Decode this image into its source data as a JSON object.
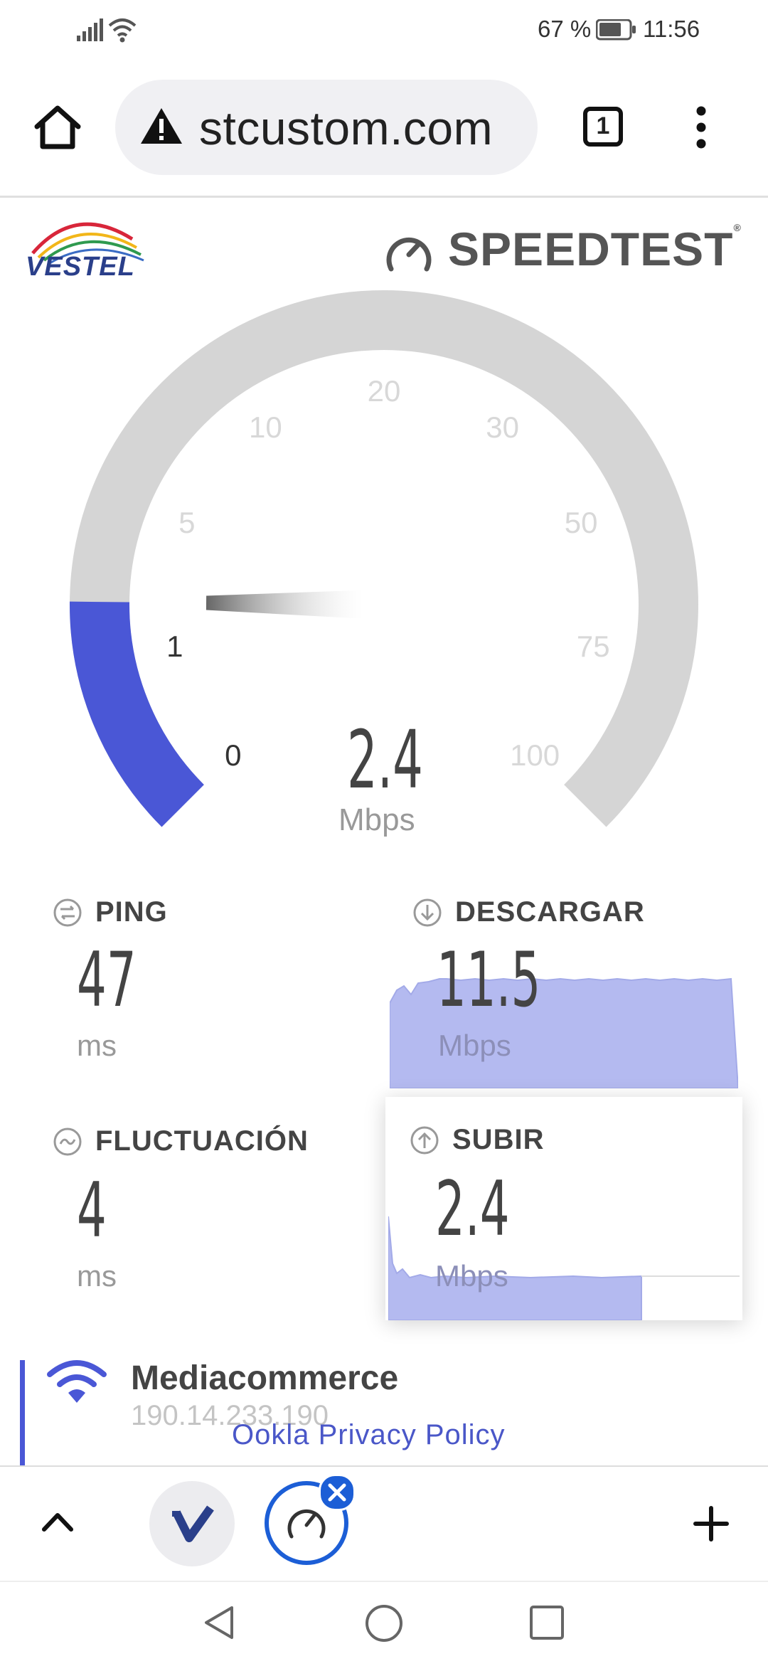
{
  "status": {
    "battery": "67 %",
    "time": "11:56"
  },
  "browser": {
    "url": "stcustom.com",
    "tab_count": "1"
  },
  "brand": {
    "logo_text": "VESTEL",
    "speedtest_label": "SPEEDTEST",
    "trademark": "®"
  },
  "gauge": {
    "ticks": [
      "0",
      "1",
      "5",
      "10",
      "20",
      "30",
      "50",
      "75",
      "100"
    ],
    "value": "2.4",
    "unit": "Mbps",
    "accent": "#4a57d6",
    "track": "#d5d5d5"
  },
  "metrics": {
    "ping": {
      "title": "PING",
      "value": "47",
      "unit": "ms"
    },
    "download": {
      "title": "DESCARGAR",
      "value": "11.5",
      "unit": "Mbps"
    },
    "jitter": {
      "title": "FLUCTUACIÓN",
      "value": "4",
      "unit": "ms"
    },
    "upload": {
      "title": "SUBIR",
      "value": "2.4",
      "unit": "Mbps"
    }
  },
  "provider": {
    "name": "Mediacommerce",
    "ip": "190.14.233.190"
  },
  "footer": {
    "privacy_link": "Ookla Privacy Policy"
  }
}
